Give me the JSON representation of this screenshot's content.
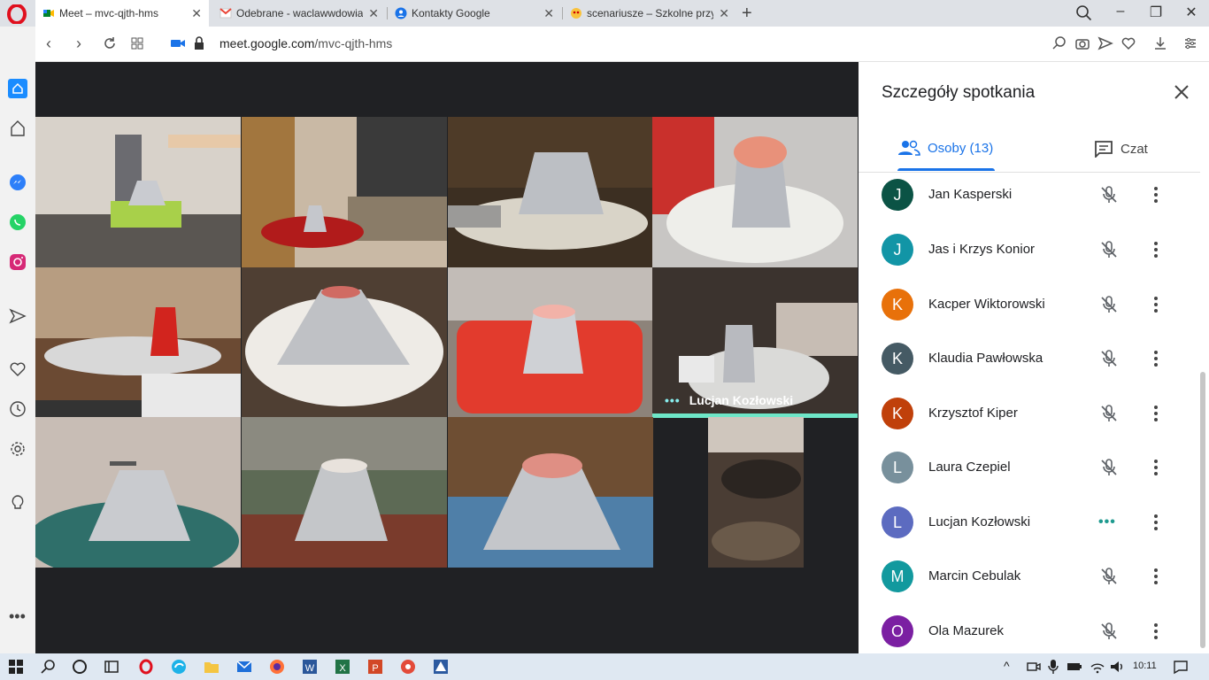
{
  "browser": {
    "tabs": [
      {
        "title": "Meet – mvc-qjth-hms",
        "icon": "google-meet-icon"
      },
      {
        "title": "Odebrane - waclawwdowia",
        "icon": "gmail-icon"
      },
      {
        "title": "Kontakty Google",
        "icon": "contacts-icon"
      },
      {
        "title": "scenariusze – Szkolne przy",
        "icon": "bee-icon"
      }
    ],
    "url_domain": "meet.google.com",
    "url_path": "/mvc-qjth-hms"
  },
  "meeting": {
    "speaking_name": "Lucjan Kozłowski"
  },
  "panel": {
    "title": "Szczegóły spotkania",
    "tab_people": "Osoby (13)",
    "tab_chat": "Czat",
    "participants": [
      {
        "initial": "J",
        "name": "Jan Kasperski",
        "color": "#0b5345",
        "status": "muted"
      },
      {
        "initial": "J",
        "name": "Jas i Krzys Konior",
        "color": "#1295a6",
        "status": "muted"
      },
      {
        "initial": "K",
        "name": "Kacper Wiktorowski",
        "color": "#e8710a",
        "status": "muted"
      },
      {
        "initial": "K",
        "name": "Klaudia Pawłowska",
        "color": "#455a64",
        "status": "muted"
      },
      {
        "initial": "K",
        "name": "Krzysztof Kiper",
        "color": "#c0400a",
        "status": "muted"
      },
      {
        "initial": "L",
        "name": "Laura Czepiel",
        "color": "#78909c",
        "status": "muted"
      },
      {
        "initial": "L",
        "name": "Lucjan Kozłowski",
        "color": "#5c6bc0",
        "status": "speaking"
      },
      {
        "initial": "M",
        "name": "Marcin Cebulak",
        "color": "#12999e",
        "status": "muted"
      },
      {
        "initial": "O",
        "name": "Ola Mazurek",
        "color": "#7b1fa2",
        "status": "muted"
      }
    ]
  },
  "taskbar": {
    "time": "10:11"
  },
  "colors": {
    "accent": "#1a73e8",
    "speaking": "#6ee7c8",
    "stage": "#202124"
  }
}
